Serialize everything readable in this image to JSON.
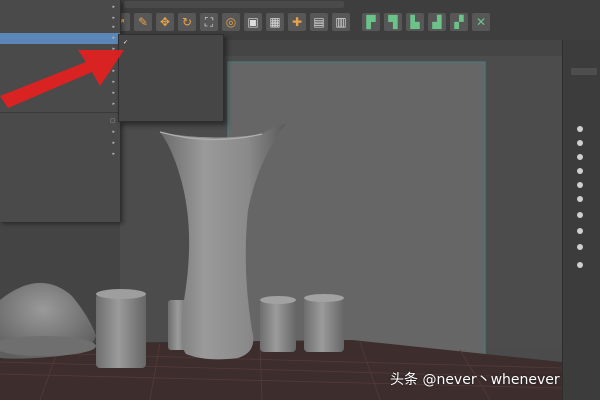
{
  "colors": {
    "menu_highlight": "#5a86b8",
    "annotation_arrow": "#e02020",
    "ground_plane": "#3d2d2d",
    "camera_gate": "#4b7a7a"
  },
  "watermark": "头条 @never丶whenever",
  "shelf": {
    "icons": [
      "lasso-icon",
      "paint-icon",
      "move-icon",
      "rotate-icon",
      "scale-icon",
      "snap-grid-icon",
      "snap-curve-icon",
      "snap-point-icon",
      "snap-plane-icon",
      "snap-surface-icon",
      "history-icon",
      "render-icon",
      "render-seq-icon",
      "ipr-icon",
      "render-settings-icon",
      "hypershade-icon"
    ]
  },
  "viewport": {
    "objects": [
      "vase-object",
      "left-dome-object",
      "cylinder-1",
      "cylinder-2",
      "cylinder-3",
      "cylinder-4"
    ]
  },
  "left_menu": {
    "highlighted_index": 3
  },
  "submenu": {
    "checked_index": 0
  },
  "right_panel": {
    "rows": 10
  }
}
